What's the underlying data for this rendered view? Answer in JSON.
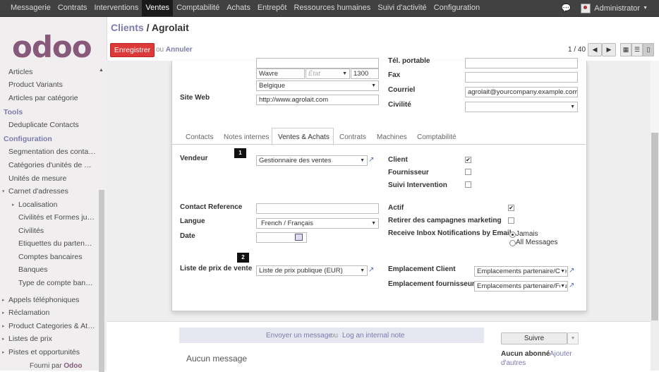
{
  "topbar": {
    "menu": [
      "Messagerie",
      "Contrats",
      "Interventions",
      "Ventes",
      "Comptabilité",
      "Achats",
      "Entrepôt",
      "Ressources humaines",
      "Suivi d'activité",
      "Configuration"
    ],
    "active_index": 3,
    "user": "Administrator"
  },
  "sidebar": {
    "logo": "odoo",
    "items": [
      {
        "label": "Articles",
        "type": "item"
      },
      {
        "label": "Product Variants",
        "type": "item"
      },
      {
        "label": "Articles par catégorie",
        "type": "item"
      },
      {
        "label": "Tools",
        "type": "section"
      },
      {
        "label": "Deduplicate Contacts",
        "type": "item"
      },
      {
        "label": "Configuration",
        "type": "section"
      },
      {
        "label": "Segmentation des contacts",
        "type": "item"
      },
      {
        "label": "Catégories d'unités de mesure",
        "type": "item"
      },
      {
        "label": "Unités de mesure",
        "type": "item"
      },
      {
        "label": "Carnet d'adresses",
        "type": "item"
      },
      {
        "label": "Localisation",
        "type": "item"
      },
      {
        "label": "Civilités et Formes juridiques",
        "type": "item"
      },
      {
        "label": "Civilités",
        "type": "item"
      },
      {
        "label": "Etiquettes du partenaire",
        "type": "item"
      },
      {
        "label": "Comptes bancaires",
        "type": "item"
      },
      {
        "label": "Banques",
        "type": "item"
      },
      {
        "label": "Type de compte bancaire",
        "type": "item"
      },
      {
        "label": "Appels téléphoniques",
        "type": "item"
      },
      {
        "label": "Réclamation",
        "type": "item"
      },
      {
        "label": "Product Categories & Attributes",
        "type": "item"
      },
      {
        "label": "Listes de prix",
        "type": "item"
      },
      {
        "label": "Pistes et opportunités",
        "type": "item"
      }
    ],
    "footer_prefix": "Fourni par",
    "footer_brand": "Odoo"
  },
  "header": {
    "breadcrumb_parent": "Clients",
    "breadcrumb_sep": "/",
    "breadcrumb_current": "Agrolait",
    "save_label": "Enregistrer",
    "or_label": "ou",
    "cancel_label": "Annuler",
    "pager": "1 / 40"
  },
  "address": {
    "city": "Wavre",
    "state_placeholder": "État",
    "zip": "1300",
    "country": "Belgique",
    "website_label": "Site Web",
    "website": "http://www.agrolait.com",
    "mobile_label": "Tél. portable",
    "fax_label": "Fax",
    "email_label": "Courriel",
    "email": "agrolait@yourcompany.example.com",
    "title_label": "Civilité"
  },
  "tabs": [
    "Contacts",
    "Notes internes",
    "Ventes & Achats",
    "Contrats",
    "Machines",
    "Comptabilité"
  ],
  "active_tab": "Ventes & Achats",
  "sales": {
    "vendeur_label": "Vendeur",
    "vendeur_value": "Gestionnaire des ventes",
    "client_label": "Client",
    "client_checked": true,
    "fournisseur_label": "Fournisseur",
    "fournisseur_checked": false,
    "suivi_label": "Suivi Intervention",
    "suivi_checked": false,
    "contact_ref_label": "Contact Reference",
    "contact_ref_value": "",
    "langue_label": "Langue",
    "langue_value": "French / Français",
    "date_label": "Date",
    "date_value": "",
    "actif_label": "Actif",
    "actif_checked": true,
    "retirer_label": "Retirer des campagnes marketing",
    "retirer_checked": false,
    "inbox_label": "Receive Inbox Notifications by Email",
    "inbox_options": [
      "Jamais",
      "All Messages"
    ],
    "inbox_selected": "Jamais",
    "pricelist_label": "Liste de prix de vente",
    "pricelist_value": "Liste de prix publique (EUR)",
    "loc_client_label": "Emplacement Client",
    "loc_client_value": "Emplacements partenaire/Clients",
    "loc_supplier_label": "Emplacement fournisseur",
    "loc_supplier_value": "Emplacements partenaire/Fournisseurs",
    "badge1": "1",
    "badge2": "2"
  },
  "chatter": {
    "send_message": "Envoyer un message",
    "or_label": "ou",
    "log_note": "Log an internal note",
    "no_message": "Aucun message",
    "follow_button": "Suivre",
    "followers_none": "Aucun abonné",
    "add_followers_1": "Ajouter",
    "add_followers_2": "d'autres"
  }
}
